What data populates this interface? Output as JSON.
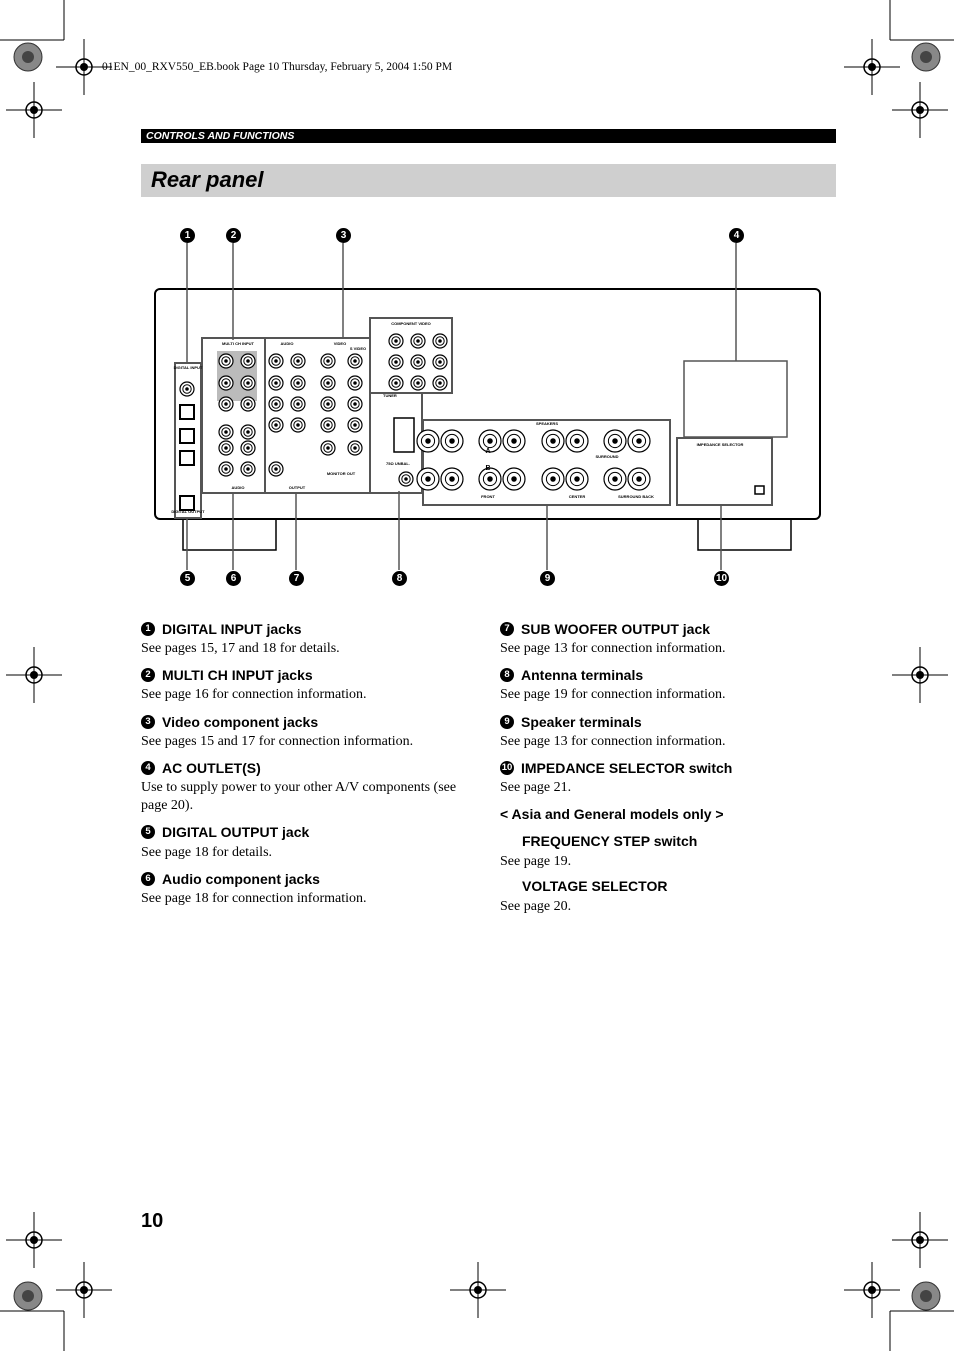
{
  "print_line": "01EN_00_RXV550_EB.book  Page 10  Thursday, February 5, 2004  1:50 PM",
  "section": "CONTROLS AND FUNCTIONS",
  "title": "Rear panel",
  "page_number": "10",
  "diagram": {
    "callouts_top": [
      "1",
      "2",
      "3",
      "4"
    ],
    "callouts_bottom": [
      "5",
      "6",
      "7",
      "8",
      "9",
      "10"
    ],
    "labels": {
      "digital_input": "DIGITAL INPUT",
      "digital_output": "DIGITAL OUTPUT",
      "multi_ch_input": "MULTI CH INPUT",
      "audio": "AUDIO",
      "video": "VIDEO",
      "s_video": "S VIDEO",
      "component_video": "COMPONENT VIDEO",
      "monitor_out": "MONITOR OUT",
      "output": "OUTPUT",
      "tuner": "TUNER",
      "speakers": "SPEAKERS",
      "front": "FRONT",
      "center": "CENTER",
      "surround": "SURROUND",
      "surround_back": "SURROUND BACK",
      "impedance_selector": "IMPEDANCE SELECTOR",
      "unbal": "75Ω UNBAL.",
      "a": "A",
      "b": "B"
    }
  },
  "left_items": [
    {
      "num": "1",
      "heading": "DIGITAL INPUT jacks",
      "body": "See pages 15, 17 and 18 for details."
    },
    {
      "num": "2",
      "heading": "MULTI CH INPUT jacks",
      "body": "See page 16 for connection information."
    },
    {
      "num": "3",
      "heading": "Video component jacks",
      "body": "See pages 15 and 17 for connection information."
    },
    {
      "num": "4",
      "heading": "AC OUTLET(S)",
      "body": "Use to supply power to your other A/V components (see page 20)."
    },
    {
      "num": "5",
      "heading": "DIGITAL OUTPUT jack",
      "body": "See page 18 for details."
    },
    {
      "num": "6",
      "heading": "Audio component jacks",
      "body": "See page 18 for connection information."
    }
  ],
  "right_items": [
    {
      "num": "7",
      "heading": "SUB WOOFER OUTPUT jack",
      "body": "See page 13 for connection information."
    },
    {
      "num": "8",
      "heading": "Antenna terminals",
      "body": "See page 19 for connection information."
    },
    {
      "num": "9",
      "heading": "Speaker terminals",
      "body": "See page 13 for connection information."
    },
    {
      "num": "10",
      "heading": "IMPEDANCE SELECTOR switch",
      "body": "See page 21."
    }
  ],
  "asia_note": {
    "heading": "< Asia and General models only >",
    "items": [
      {
        "heading": "FREQUENCY STEP switch",
        "body": "See page 19."
      },
      {
        "heading": "VOLTAGE SELECTOR",
        "body": "See page 20."
      }
    ]
  }
}
